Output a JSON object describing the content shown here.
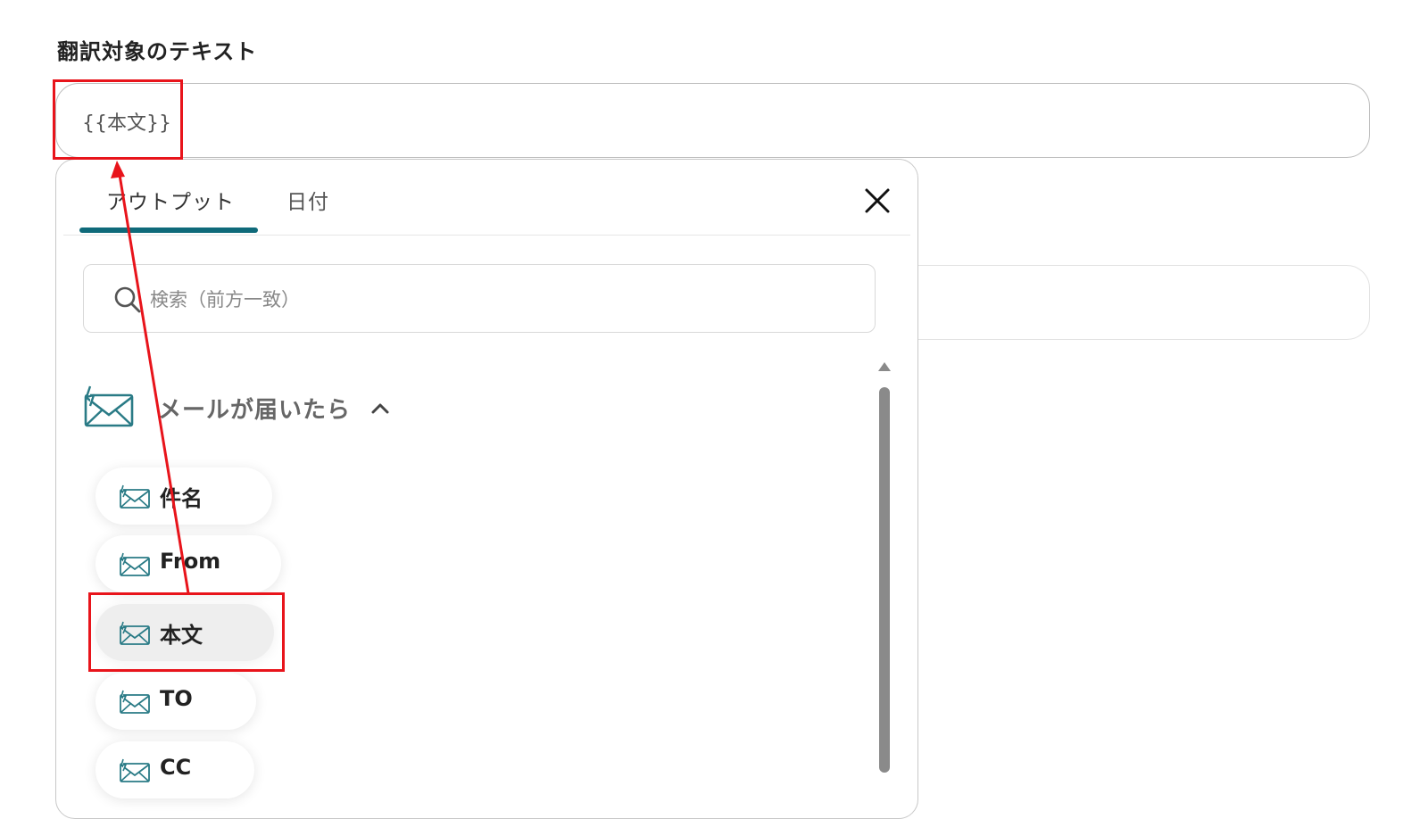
{
  "field": {
    "label": "翻訳対象のテキスト",
    "value": "{{本文}}"
  },
  "popover": {
    "tabs": [
      {
        "label": "アウトプット",
        "active": true
      },
      {
        "label": "日付",
        "active": false
      }
    ],
    "close_icon": "close-icon",
    "search": {
      "placeholder": "検索（前方一致）",
      "value": "",
      "icon": "search-icon"
    },
    "group": {
      "title": "メールが届いたら",
      "icon": "mail-trigger-icon",
      "expanded": true,
      "items": [
        {
          "label": "件名",
          "selected": false
        },
        {
          "label": "From",
          "selected": false
        },
        {
          "label": "本文",
          "selected": true
        },
        {
          "label": "TO",
          "selected": false
        },
        {
          "label": "CC",
          "selected": false
        }
      ]
    }
  },
  "colors": {
    "accent": "#0f6a7a",
    "highlight": "#e8141b",
    "icon": "#2a7b86"
  }
}
